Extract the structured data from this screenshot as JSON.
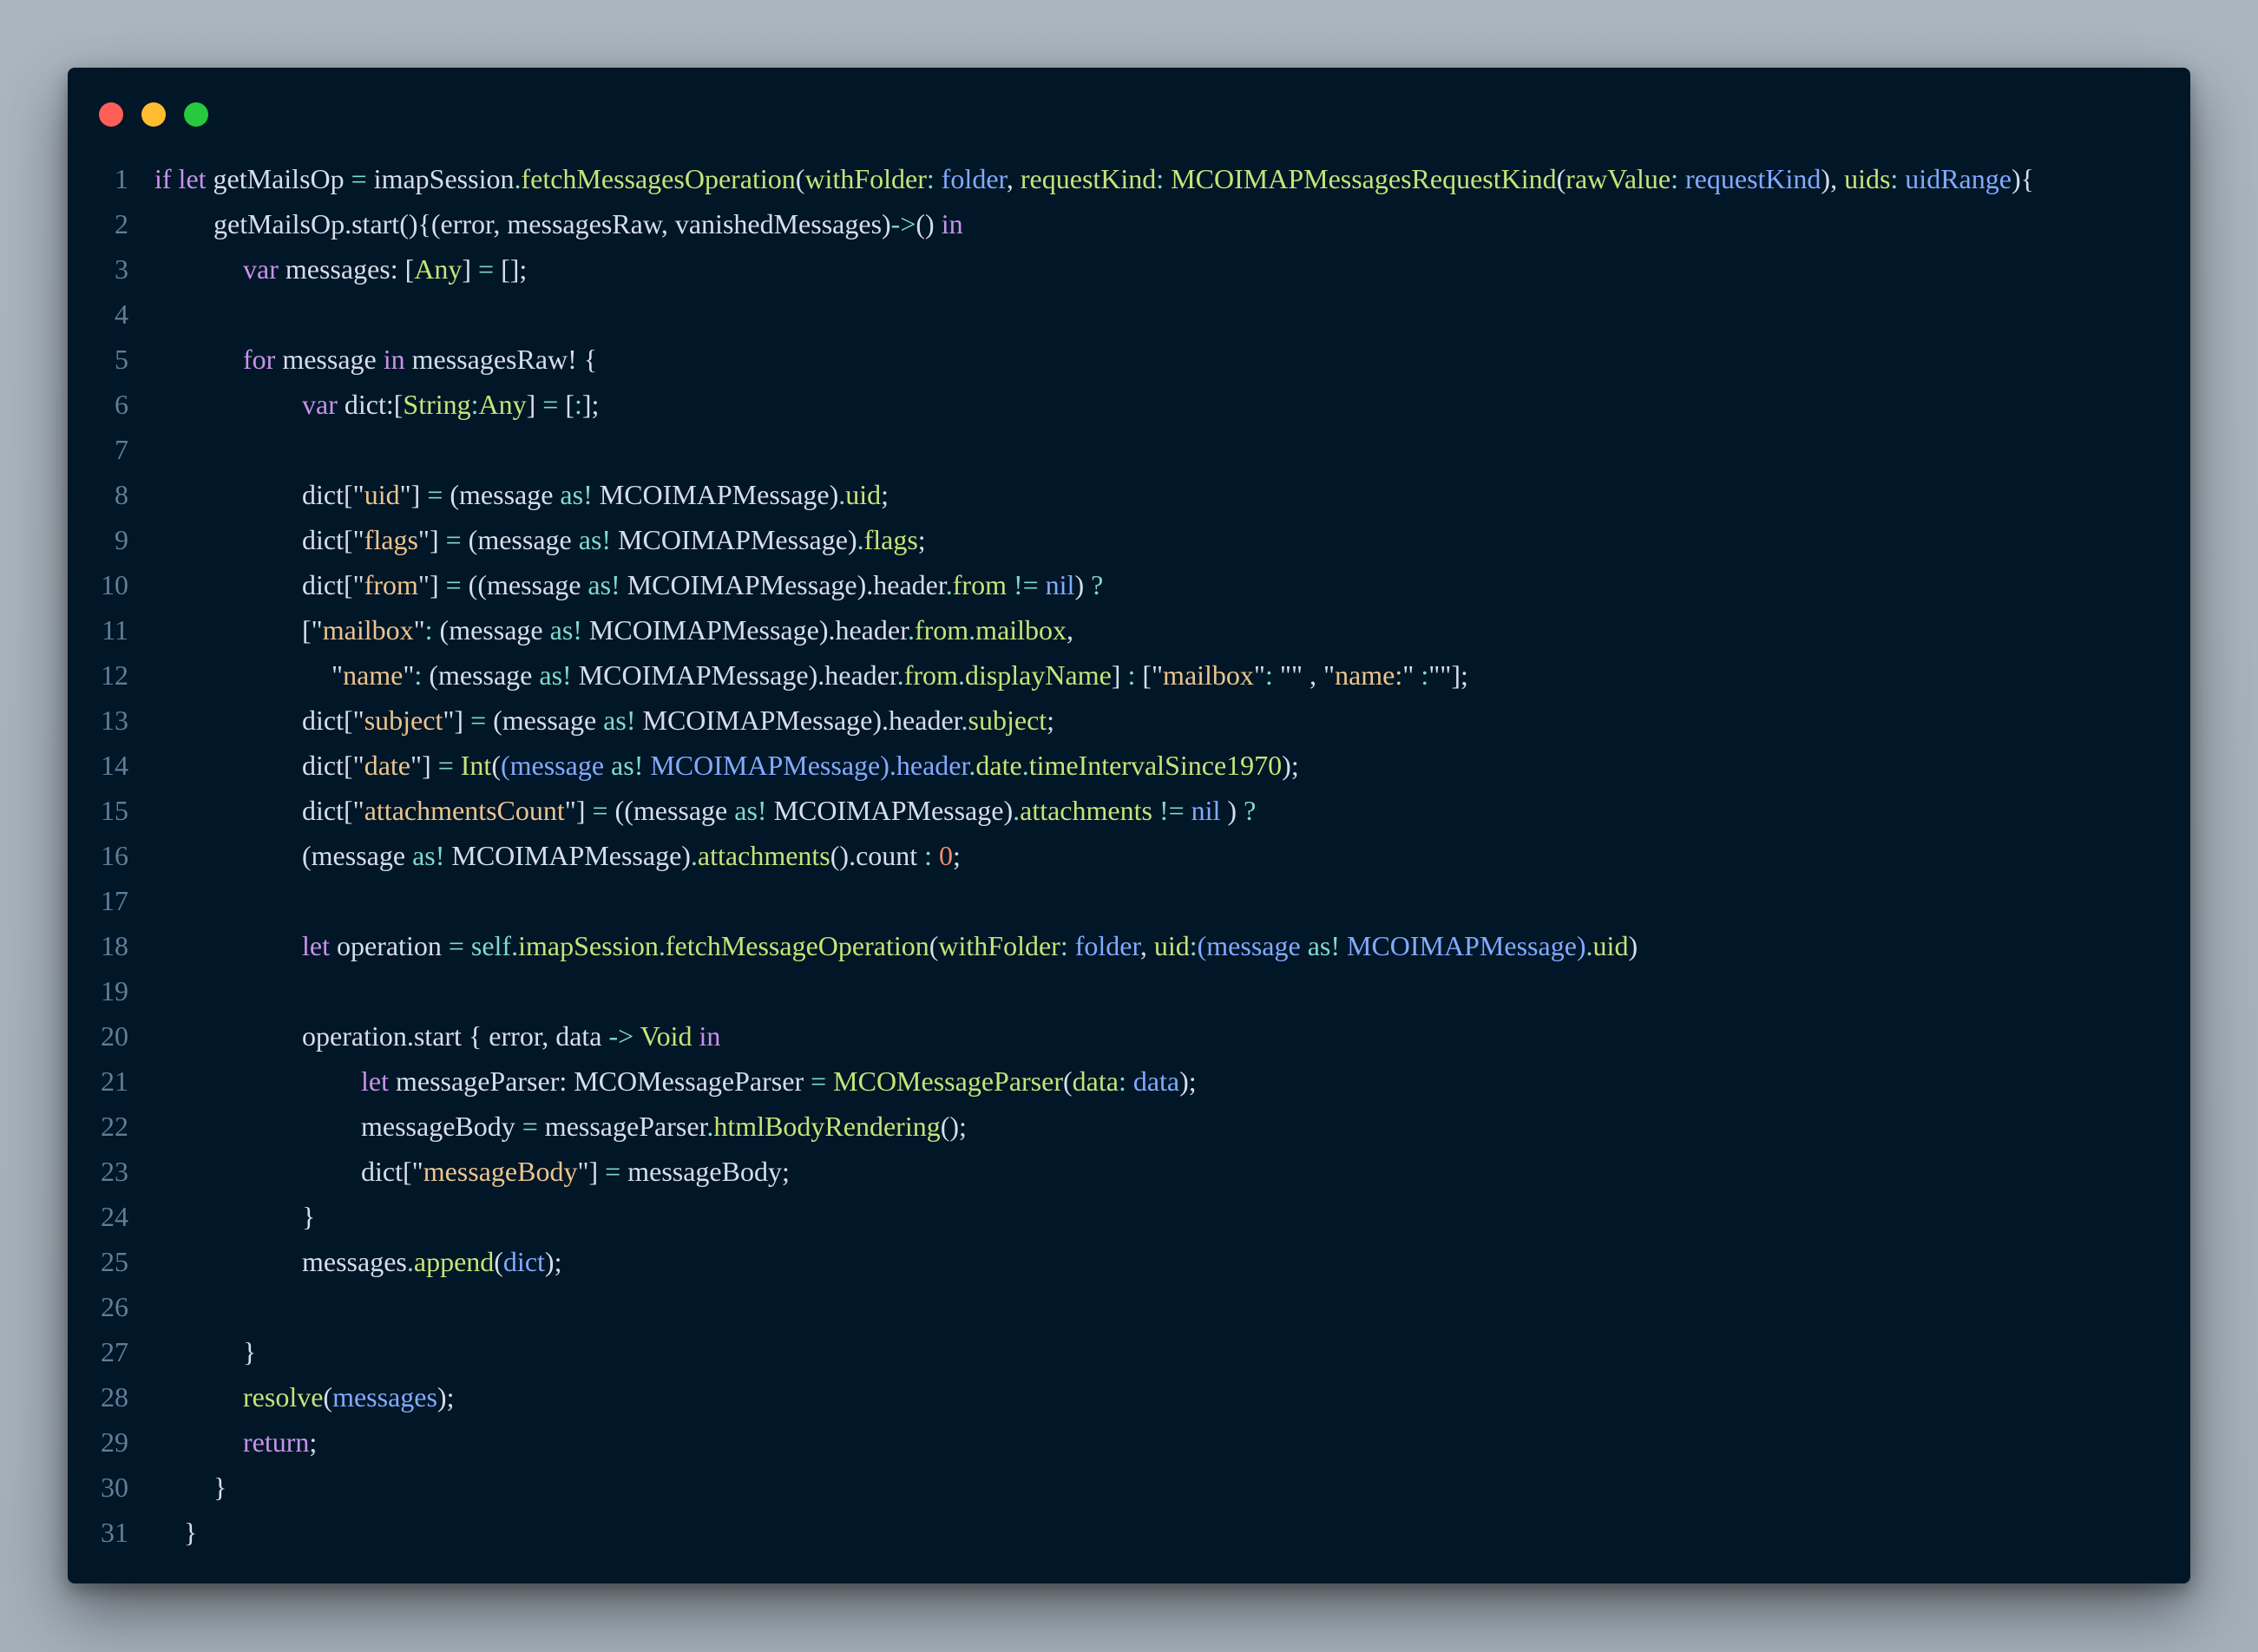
{
  "window": {
    "controls": [
      "close",
      "minimize",
      "maximize"
    ],
    "colors": {
      "close": "#ff5f56",
      "minimize": "#ffbd2e",
      "maximize": "#27c93f"
    }
  },
  "editor": {
    "theme": {
      "background": "#011627",
      "line_number": "#5f7e97",
      "default": "#d6deeb"
    },
    "token_colors": {
      "t": "#d6deeb",
      "k": "#c792ea",
      "f": "#c5e478",
      "p": "#82aaff",
      "s": "#ecc48d",
      "o": "#7fdbca",
      "n": "#f78c6c"
    },
    "lines": [
      {
        "num": "1",
        "indent": 0,
        "tokens": [
          [
            "k",
            "if let"
          ],
          [
            "t",
            " getMailsOp "
          ],
          [
            "o",
            "="
          ],
          [
            "t",
            " imapSession"
          ],
          [
            "o",
            "."
          ],
          [
            "f",
            "fetchMessagesOperation"
          ],
          [
            "t",
            "("
          ],
          [
            "f",
            "withFolder"
          ],
          [
            "o",
            ":"
          ],
          [
            "p",
            " folder"
          ],
          [
            "t",
            ", "
          ],
          [
            "f",
            "requestKind"
          ],
          [
            "o",
            ":"
          ],
          [
            "f",
            " MCOIMAPMessagesRequestKind"
          ],
          [
            "t",
            "("
          ],
          [
            "f",
            "rawValue"
          ],
          [
            "o",
            ":"
          ],
          [
            "p",
            " requestKind"
          ],
          [
            "t",
            "), "
          ],
          [
            "f",
            "uids"
          ],
          [
            "o",
            ":"
          ],
          [
            "p",
            " uidRange"
          ],
          [
            "t",
            "){"
          ]
        ]
      },
      {
        "num": "2",
        "indent": 2,
        "tokens": [
          [
            "t",
            "getMailsOp.start(){(error, messagesRaw, vanishedMessages)"
          ],
          [
            "o",
            "->"
          ],
          [
            "t",
            "() "
          ],
          [
            "k",
            "in"
          ]
        ]
      },
      {
        "num": "3",
        "indent": 3,
        "tokens": [
          [
            "k",
            "var"
          ],
          [
            "t",
            " messages: ["
          ],
          [
            "f",
            "Any"
          ],
          [
            "t",
            "] "
          ],
          [
            "o",
            "="
          ],
          [
            "t",
            " [];"
          ]
        ]
      },
      {
        "num": "4",
        "indent": 0,
        "tokens": []
      },
      {
        "num": "5",
        "indent": 3,
        "tokens": [
          [
            "k",
            "for"
          ],
          [
            "t",
            " message "
          ],
          [
            "k",
            "in"
          ],
          [
            "t",
            " messagesRaw! {"
          ]
        ]
      },
      {
        "num": "6",
        "indent": 5,
        "tokens": [
          [
            "k",
            "var"
          ],
          [
            "t",
            " dict:["
          ],
          [
            "f",
            "String"
          ],
          [
            "o",
            ":"
          ],
          [
            "f",
            "Any"
          ],
          [
            "t",
            "] "
          ],
          [
            "o",
            "="
          ],
          [
            "t",
            " ["
          ],
          [
            "o",
            ":"
          ],
          [
            "t",
            "];"
          ]
        ]
      },
      {
        "num": "7",
        "indent": 0,
        "tokens": []
      },
      {
        "num": "8",
        "indent": 5,
        "tokens": [
          [
            "t",
            "dict[\""
          ],
          [
            "s",
            "uid"
          ],
          [
            "t",
            "\"] "
          ],
          [
            "o",
            "="
          ],
          [
            "t",
            " (message "
          ],
          [
            "o",
            "as!"
          ],
          [
            "t",
            " MCOIMAPMessage)"
          ],
          [
            "o",
            "."
          ],
          [
            "f",
            "uid"
          ],
          [
            "t",
            ";"
          ]
        ]
      },
      {
        "num": "9",
        "indent": 5,
        "tokens": [
          [
            "t",
            "dict[\""
          ],
          [
            "s",
            "flags"
          ],
          [
            "t",
            "\"] "
          ],
          [
            "o",
            "="
          ],
          [
            "t",
            " (message "
          ],
          [
            "o",
            "as!"
          ],
          [
            "t",
            " MCOIMAPMessage)"
          ],
          [
            "o",
            "."
          ],
          [
            "f",
            "flags"
          ],
          [
            "t",
            ";"
          ]
        ]
      },
      {
        "num": "10",
        "indent": 5,
        "tokens": [
          [
            "t",
            "dict[\""
          ],
          [
            "s",
            "from"
          ],
          [
            "t",
            "\"] "
          ],
          [
            "o",
            "="
          ],
          [
            "t",
            " ((message "
          ],
          [
            "o",
            "as!"
          ],
          [
            "t",
            " MCOIMAPMessage).header"
          ],
          [
            "o",
            "."
          ],
          [
            "f",
            "from"
          ],
          [
            "o",
            " !="
          ],
          [
            "p",
            " nil"
          ],
          [
            "t",
            ") "
          ],
          [
            "o",
            "?"
          ]
        ]
      },
      {
        "num": "11",
        "indent": 5,
        "tokens": [
          [
            "t",
            "[\""
          ],
          [
            "s",
            "mailbox"
          ],
          [
            "t",
            "\""
          ],
          [
            "o",
            ":"
          ],
          [
            "t",
            " (message "
          ],
          [
            "o",
            "as!"
          ],
          [
            "t",
            " MCOIMAPMessage).header"
          ],
          [
            "o",
            "."
          ],
          [
            "f",
            "from"
          ],
          [
            "o",
            "."
          ],
          [
            "f",
            "mailbox"
          ],
          [
            "t",
            ","
          ]
        ]
      },
      {
        "num": "12",
        "indent": 6,
        "tokens": [
          [
            "t",
            "\""
          ],
          [
            "s",
            "name"
          ],
          [
            "t",
            "\""
          ],
          [
            "o",
            ":"
          ],
          [
            "t",
            " (message "
          ],
          [
            "o",
            "as!"
          ],
          [
            "t",
            " MCOIMAPMessage).header"
          ],
          [
            "o",
            "."
          ],
          [
            "f",
            "from"
          ],
          [
            "o",
            "."
          ],
          [
            "f",
            "displayName"
          ],
          [
            "t",
            "] "
          ],
          [
            "o",
            ":"
          ],
          [
            "t",
            " [\""
          ],
          [
            "s",
            "mailbox"
          ],
          [
            "t",
            "\""
          ],
          [
            "o",
            ":"
          ],
          [
            "t",
            " \"\" , \""
          ],
          [
            "s",
            "name:"
          ],
          [
            "t",
            "\" "
          ],
          [
            "o",
            ":"
          ],
          [
            "t",
            "\"\"];"
          ]
        ]
      },
      {
        "num": "13",
        "indent": 5,
        "tokens": [
          [
            "t",
            "dict[\""
          ],
          [
            "s",
            "subject"
          ],
          [
            "t",
            "\"] "
          ],
          [
            "o",
            "="
          ],
          [
            "t",
            " (message "
          ],
          [
            "o",
            "as!"
          ],
          [
            "t",
            " MCOIMAPMessage).header"
          ],
          [
            "o",
            "."
          ],
          [
            "f",
            "subject"
          ],
          [
            "t",
            ";"
          ]
        ]
      },
      {
        "num": "14",
        "indent": 5,
        "tokens": [
          [
            "t",
            "dict[\""
          ],
          [
            "s",
            "date"
          ],
          [
            "t",
            "\"] "
          ],
          [
            "o",
            "="
          ],
          [
            "f",
            " Int"
          ],
          [
            "t",
            "("
          ],
          [
            "p",
            "(message "
          ],
          [
            "o",
            "as!"
          ],
          [
            "p",
            " MCOIMAPMessage).header"
          ],
          [
            "o",
            "."
          ],
          [
            "f",
            "date"
          ],
          [
            "o",
            "."
          ],
          [
            "f",
            "timeIntervalSince1970"
          ],
          [
            "t",
            ");"
          ]
        ]
      },
      {
        "num": "15",
        "indent": 5,
        "tokens": [
          [
            "t",
            "dict[\""
          ],
          [
            "s",
            "attachmentsCount"
          ],
          [
            "t",
            "\"] "
          ],
          [
            "o",
            "="
          ],
          [
            "t",
            " ((message "
          ],
          [
            "o",
            "as!"
          ],
          [
            "t",
            " MCOIMAPMessage)"
          ],
          [
            "o",
            "."
          ],
          [
            "f",
            "attachments"
          ],
          [
            "o",
            " !="
          ],
          [
            "p",
            " nil"
          ],
          [
            "t",
            " ) "
          ],
          [
            "o",
            "?"
          ]
        ]
      },
      {
        "num": "16",
        "indent": 5,
        "tokens": [
          [
            "t",
            "(message "
          ],
          [
            "o",
            "as!"
          ],
          [
            "t",
            " MCOIMAPMessage)"
          ],
          [
            "o",
            "."
          ],
          [
            "f",
            "attachments"
          ],
          [
            "t",
            "().count "
          ],
          [
            "o",
            ":"
          ],
          [
            "n",
            " 0"
          ],
          [
            "t",
            ";"
          ]
        ]
      },
      {
        "num": "17",
        "indent": 0,
        "tokens": []
      },
      {
        "num": "18",
        "indent": 5,
        "tokens": [
          [
            "k",
            "let"
          ],
          [
            "t",
            " operation "
          ],
          [
            "o",
            "="
          ],
          [
            "o",
            " self"
          ],
          [
            "o",
            "."
          ],
          [
            "f",
            "imapSession"
          ],
          [
            "o",
            "."
          ],
          [
            "f",
            "fetchMessageOperation"
          ],
          [
            "t",
            "("
          ],
          [
            "f",
            "withFolder"
          ],
          [
            "o",
            ":"
          ],
          [
            "p",
            " folder"
          ],
          [
            "t",
            ", "
          ],
          [
            "f",
            "uid"
          ],
          [
            "o",
            ":"
          ],
          [
            "p",
            "(message "
          ],
          [
            "o",
            "as!"
          ],
          [
            "p",
            " MCOIMAPMessage)"
          ],
          [
            "o",
            "."
          ],
          [
            "f",
            "uid"
          ],
          [
            "t",
            ")"
          ]
        ]
      },
      {
        "num": "19",
        "indent": 0,
        "tokens": []
      },
      {
        "num": "20",
        "indent": 5,
        "tokens": [
          [
            "t",
            "operation.start { error, data "
          ],
          [
            "o",
            "->"
          ],
          [
            "f",
            " Void"
          ],
          [
            "k",
            " in"
          ]
        ]
      },
      {
        "num": "21",
        "indent": 7,
        "tokens": [
          [
            "k",
            "let"
          ],
          [
            "t",
            " messageParser: MCOMessageParser "
          ],
          [
            "o",
            "="
          ],
          [
            "f",
            " MCOMessageParser"
          ],
          [
            "t",
            "("
          ],
          [
            "f",
            "data"
          ],
          [
            "o",
            ":"
          ],
          [
            "p",
            " data"
          ],
          [
            "t",
            ");"
          ]
        ]
      },
      {
        "num": "22",
        "indent": 7,
        "tokens": [
          [
            "t",
            "messageBody "
          ],
          [
            "o",
            "="
          ],
          [
            "t",
            " messageParser"
          ],
          [
            "o",
            "."
          ],
          [
            "f",
            "htmlBodyRendering"
          ],
          [
            "t",
            "();"
          ]
        ]
      },
      {
        "num": "23",
        "indent": 7,
        "tokens": [
          [
            "t",
            "dict[\""
          ],
          [
            "s",
            "messageBody"
          ],
          [
            "t",
            "\"] "
          ],
          [
            "o",
            "="
          ],
          [
            "t",
            " messageBody;"
          ]
        ]
      },
      {
        "num": "24",
        "indent": 5,
        "tokens": [
          [
            "t",
            "}"
          ]
        ]
      },
      {
        "num": "25",
        "indent": 5,
        "tokens": [
          [
            "t",
            "messages"
          ],
          [
            "o",
            "."
          ],
          [
            "f",
            "append"
          ],
          [
            "t",
            "("
          ],
          [
            "p",
            "dict"
          ],
          [
            "t",
            ");"
          ]
        ]
      },
      {
        "num": "26",
        "indent": 0,
        "tokens": []
      },
      {
        "num": "27",
        "indent": 3,
        "tokens": [
          [
            "t",
            "}"
          ]
        ]
      },
      {
        "num": "28",
        "indent": 3,
        "tokens": [
          [
            "f",
            "resolve"
          ],
          [
            "t",
            "("
          ],
          [
            "p",
            "messages"
          ],
          [
            "t",
            ");"
          ]
        ]
      },
      {
        "num": "29",
        "indent": 3,
        "tokens": [
          [
            "k",
            "return"
          ],
          [
            "t",
            ";"
          ]
        ]
      },
      {
        "num": "30",
        "indent": 2,
        "tokens": [
          [
            "t",
            "}"
          ]
        ]
      },
      {
        "num": "31",
        "indent": 1,
        "tokens": [
          [
            "t",
            "}"
          ]
        ]
      }
    ]
  }
}
